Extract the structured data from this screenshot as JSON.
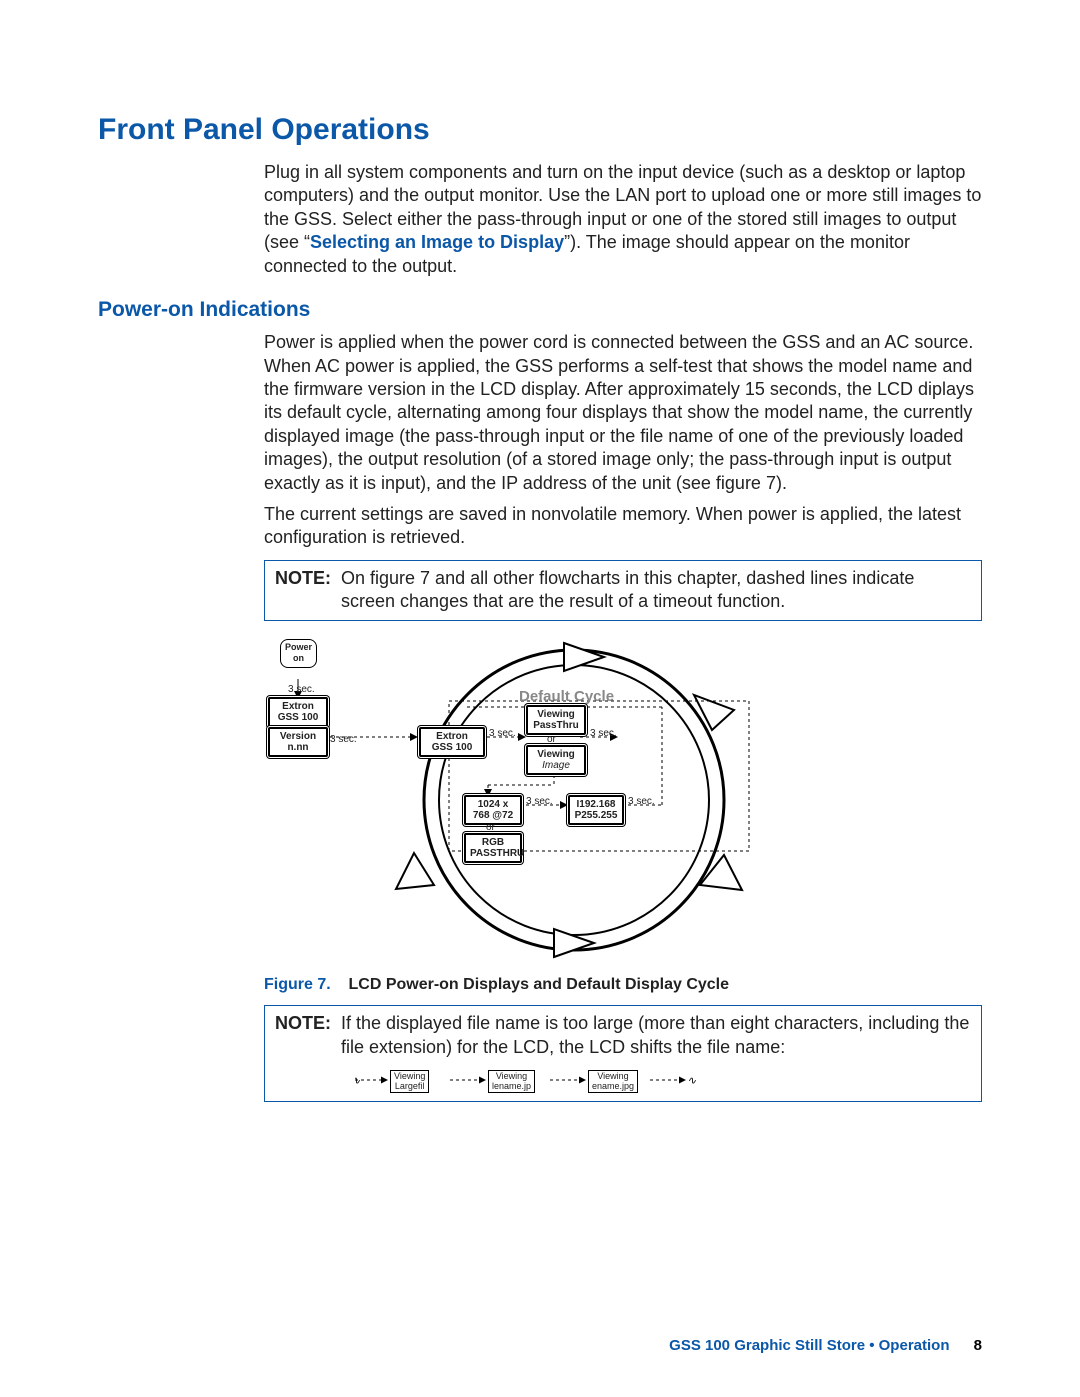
{
  "headings": {
    "main": "Front Panel Operations",
    "sub": "Power-on Indications"
  },
  "intro": {
    "p1_before_link": "Plug in all system components and turn on the input device (such as a desktop or laptop computers) and the output monitor. Use the LAN port to upload one or more still images to the GSS. Select either the pass-through input or one of the stored still images to output (see “",
    "link": "Selecting an Image to Display",
    "p1_after_link": "”). The image should appear on the monitor connected to the output."
  },
  "poweron": {
    "p1": "Power is applied when the power cord is connected between the GSS and an AC source. When AC power is applied, the GSS performs a self-test that shows the model name and the firmware version in the LCD display. After approximately 15 seconds, the LCD diplays its default cycle, alternating among four displays that show the model name, the currently displayed image (the pass-through input or the file name of one of the previously loaded images), the output resolution (of a stored image only; the pass-through input is output exactly as it is input), and the IP address of the unit (see figure 7).",
    "p2": "The current settings are saved in nonvolatile memory. When power is applied, the latest configuration is retrieved."
  },
  "note1": {
    "label": "NOTE:",
    "text": "On figure 7 and all other flowcharts in this chapter, dashed lines indicate screen changes that are the result of a timeout function."
  },
  "figure7": {
    "prefix": "Figure 7.",
    "caption": "LCD Power-on Displays and Default Display Cycle",
    "cycle_label": "Default Cycle",
    "power_on": "Power\non",
    "extron": "Extron\nGSS   100",
    "version": "Version\nn.nn",
    "viewing_passthru": "Viewing\nPassThru",
    "viewing_image": "Viewing\nImage",
    "res": "1024 x\n768   @72",
    "rgb_passthru": "RGB\nPASSTHRU",
    "ip": "I192.168\nP255.255",
    "delay": "3 sec.",
    "or": "or"
  },
  "note2": {
    "label": "NOTE:",
    "text": "If the displayed file name is too large (more than eight characters, including the file extension) for the LCD, the LCD shifts the file name:",
    "scroll": [
      "Viewing\nLargefil",
      "Viewing\nlename.jp",
      "Viewing\nename.jpg"
    ]
  },
  "footer": {
    "text": "GSS 100 Graphic Still Store • Operation",
    "page": "8"
  }
}
